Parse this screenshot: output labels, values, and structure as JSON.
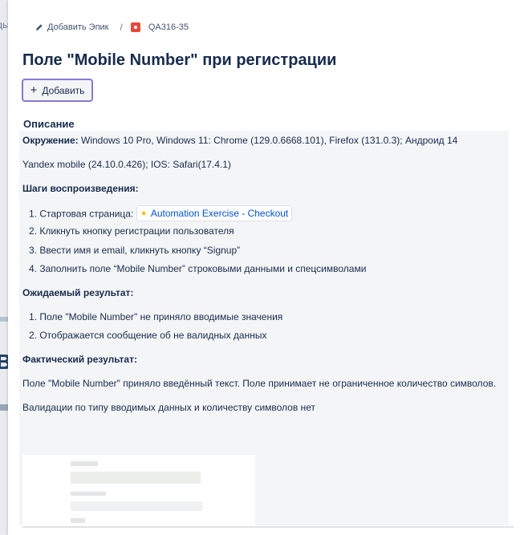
{
  "backdrop": {
    "left_text": "ды",
    "left_big": "в"
  },
  "breadcrumb": {
    "epic_label": "Добавить Эпик",
    "separator": "/",
    "issue_key": "QA316-35"
  },
  "issue": {
    "title": "Поле \"Mobile Number\" при регистрации",
    "add_button_label": "Добавить"
  },
  "description": {
    "heading": "Описание",
    "env_label": "Окружение:",
    "env_text": " Windows 10 Pro, Windows 11: Chrome (129.0.6668.101), Firefox (131.0.3); Андроид 14",
    "env_text2": "Yandex mobile (24.10.0.426); IOS: Safari(17.4.1)",
    "steps_heading": "Шаги воспроизведения:",
    "steps": [
      "1. Стартовая страница:",
      "2. Кликнуть кнопку регистрации пользователя",
      "3. Ввести имя и email, кликнуть кнопку “Signup”",
      "4. Заполнить поле “Mobile Number” строковыми данными и спецсимволами"
    ],
    "link_label": "Automation Exercise - Checkout",
    "expected_heading": "Ожидаемый результат:",
    "expected": [
      "1. Поле \"Mobile Number\" не приняло вводимые значения",
      "2. Отображается сообщение об не валидных данных"
    ],
    "actual_heading": "Фактический результат:",
    "actual_text": "Поле \"Mobile Number\" приняло введённый текст. Поле принимает не ограниченное количество  символов.",
    "actual_text2": "Валидации по типу вводимых данных и количеству символов нет"
  },
  "colors": {
    "accent": "#8777d9",
    "link": "#0052cc",
    "bug": "#e5493a"
  }
}
